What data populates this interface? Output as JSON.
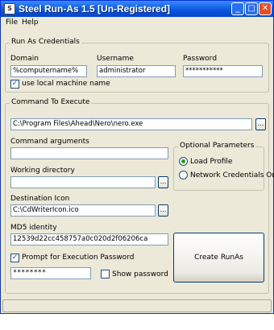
{
  "window": {
    "title": "Steel Run-As 1.5 [Un-Registered]",
    "app_icon_glyph": "S",
    "minimize_glyph": "_",
    "maximize_glyph": "□",
    "close_glyph": "✕"
  },
  "menu": {
    "file": "File",
    "help": "Help"
  },
  "credentials": {
    "legend": "Run As Credentials",
    "domain_label": "Domain",
    "domain_value": "%computername%",
    "username_label": "Username",
    "username_value": "administrator",
    "password_label": "Password",
    "password_value": "***********",
    "use_local_label": "use local machine name",
    "use_local_checked": true
  },
  "command": {
    "legend": "Command To Execute",
    "path_value": "C:\\Program Files\\Ahead\\Nero\\nero.exe",
    "browse_glyph": "...",
    "args_label": "Command arguments",
    "args_value": "",
    "workdir_label": "Working directory",
    "workdir_value": "",
    "icon_label": "Destination Icon",
    "icon_value": "C:\\CdWriterIcon.ico",
    "md5_label": "MD5 identity",
    "md5_value": "12539d22cc458757a0c020d2f06206ca",
    "prompt_label": "Prompt for Execution Password",
    "prompt_checked": true,
    "exec_password_value": "********",
    "show_password_label": "Show password",
    "show_password_checked": false,
    "create_button": "Create RunAs Executable"
  },
  "optional": {
    "legend": "Optional Parameters",
    "load_profile_label": "Load Profile",
    "load_profile_selected": true,
    "network_creds_label": "Network Credentials Only",
    "network_creds_selected": false
  },
  "status": {
    "text": ""
  }
}
